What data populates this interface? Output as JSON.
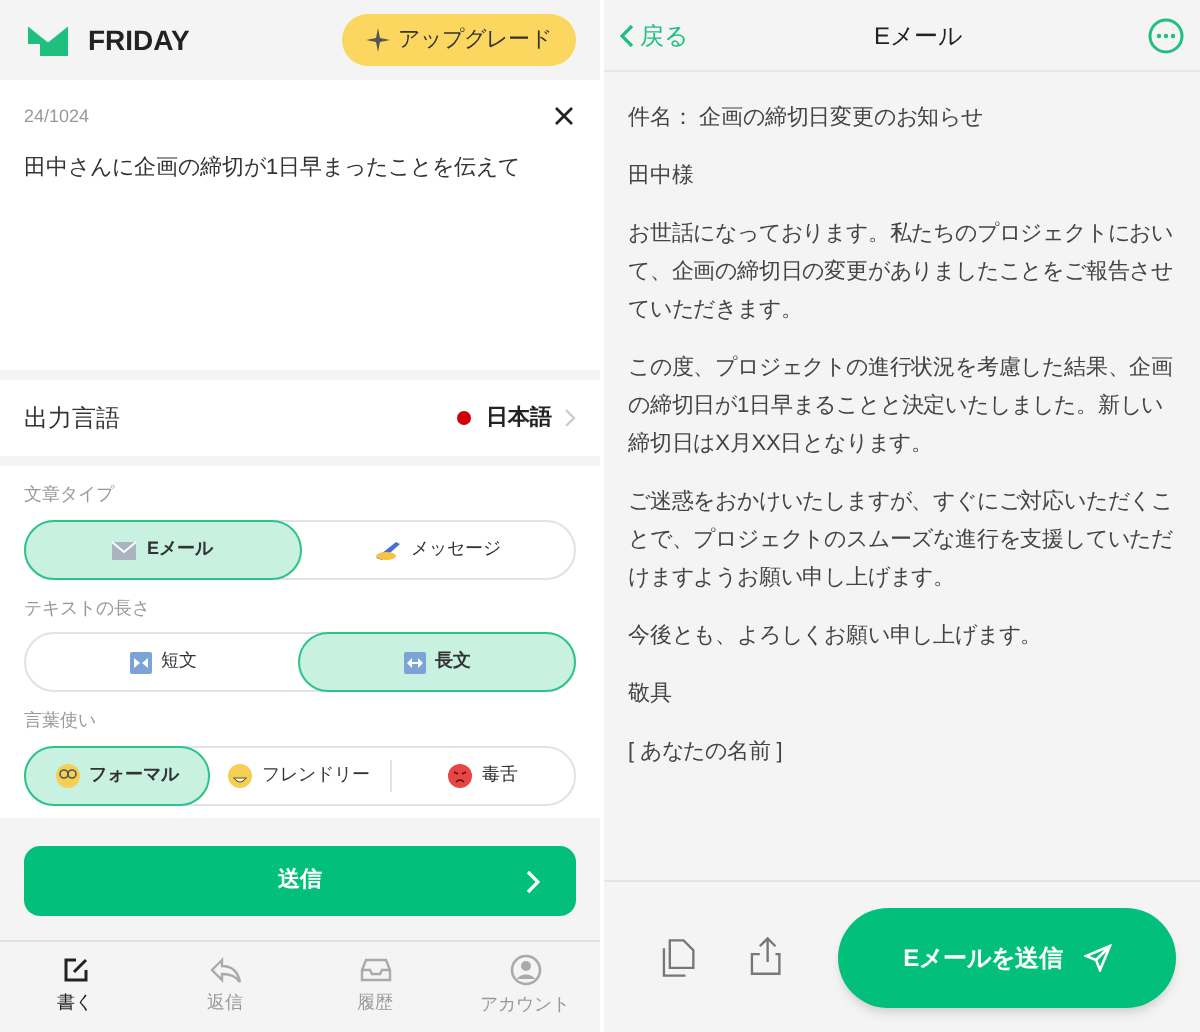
{
  "compose": {
    "app_name": "FRIDAY",
    "upgrade_button": "アップグレード",
    "prompt": {
      "counter": "24/1024",
      "text": "田中さんに企画の締切が1日早まったことを伝えて"
    },
    "output_language": {
      "label": "出力言語",
      "value": "日本語"
    },
    "option_groups": [
      {
        "label": "文章タイプ",
        "options": [
          {
            "label": "Eメール",
            "selected": true
          },
          {
            "label": "メッセージ",
            "selected": false
          }
        ]
      },
      {
        "label": "テキストの長さ",
        "options": [
          {
            "label": "短文",
            "selected": false
          },
          {
            "label": "長文",
            "selected": true
          }
        ]
      },
      {
        "label": "言葉使い",
        "options": [
          {
            "label": "フォーマル",
            "selected": true
          },
          {
            "label": "フレンドリー",
            "selected": false
          },
          {
            "label": "毒舌",
            "selected": false
          }
        ]
      }
    ],
    "send_button": "送信",
    "tab_bar": [
      {
        "label": "書く",
        "selected": true
      },
      {
        "label": "返信",
        "selected": false
      },
      {
        "label": "履歴",
        "selected": false
      },
      {
        "label": "アカウント",
        "selected": false
      }
    ]
  },
  "result": {
    "back_button": "戻る",
    "title": "Eメール",
    "body": [
      "件名： 企画の締切日変更のお知らせ",
      "田中様",
      "お世話になっております。私たちのプロジェクトにおいて、企画の締切日の変更がありましたことをご報告させていただきます。",
      "この度、プロジェクトの進行状況を考慮した結果、企画の締切日が1日早まることと決定いたしました。新しい締切日はX月XX日となります。",
      "ご迷惑をおかけいたしますが、すぐにご対応いただくことで、プロジェクトのスムーズな進行を支援していただけますようお願い申し上げます。",
      "今後とも、よろしくお願い申し上げます。",
      "敬具",
      "[ あなたの名前 ]"
    ],
    "send_button": "Eメールを送信"
  }
}
